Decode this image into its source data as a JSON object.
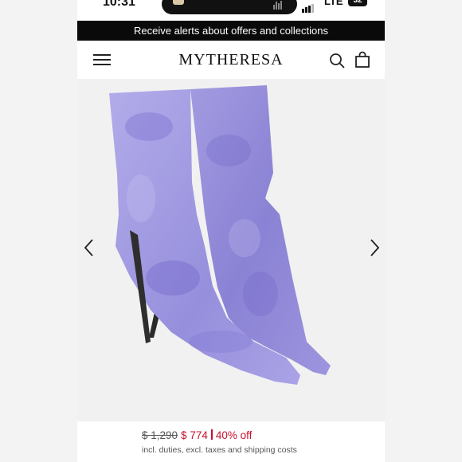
{
  "status_bar": {
    "time": "10:31",
    "network": "LTE",
    "battery": "32"
  },
  "promo_banner": {
    "text": "Receive alerts about offers and collections"
  },
  "header": {
    "brand": "MYTHERESA",
    "icons": [
      "menu-icon",
      "search-icon",
      "shopping-bag-icon"
    ]
  },
  "gallery": {
    "image": "purple velvet pointed-toe ankle boots",
    "controls": [
      "chevron-left-icon",
      "chevron-right-icon"
    ]
  },
  "price": {
    "original": "$ 1,290",
    "sale": "$ 774",
    "discount": "40% off",
    "note": "incl. duties, excl. taxes and shipping costs"
  },
  "colors": {
    "banner_bg": "#0a0a0a",
    "sale_red": "#c8102e",
    "boot_purple": "#8f86d6"
  }
}
